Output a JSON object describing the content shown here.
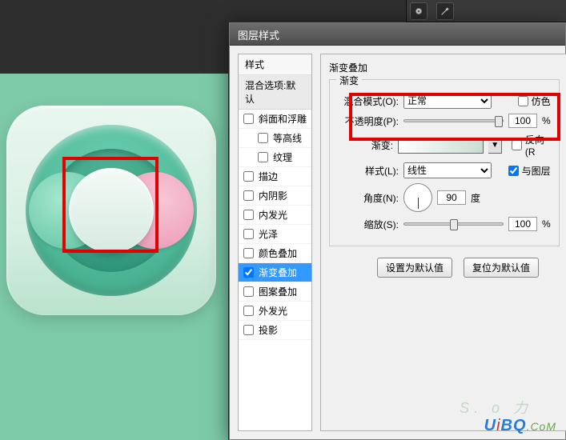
{
  "dialog": {
    "title": "图层样式",
    "styles_panel_title": "样式",
    "blend_default": "混合选项:默认",
    "styles": [
      {
        "label": "斜面和浮雕",
        "checked": false,
        "indent": false
      },
      {
        "label": "等高线",
        "checked": false,
        "indent": true
      },
      {
        "label": "纹理",
        "checked": false,
        "indent": true
      },
      {
        "label": "描边",
        "checked": false,
        "indent": false
      },
      {
        "label": "内阴影",
        "checked": false,
        "indent": false
      },
      {
        "label": "内发光",
        "checked": false,
        "indent": false
      },
      {
        "label": "光泽",
        "checked": false,
        "indent": false
      },
      {
        "label": "颜色叠加",
        "checked": false,
        "indent": false
      },
      {
        "label": "渐变叠加",
        "checked": true,
        "indent": false,
        "selected": true
      },
      {
        "label": "图案叠加",
        "checked": false,
        "indent": false
      },
      {
        "label": "外发光",
        "checked": false,
        "indent": false
      },
      {
        "label": "投影",
        "checked": false,
        "indent": false
      }
    ]
  },
  "settings": {
    "section_title": "渐变叠加",
    "fieldset_title": "渐变",
    "blend_mode_label": "混合模式(O):",
    "blend_mode_value": "正常",
    "dither_label": "仿色",
    "dither_checked": false,
    "opacity_label": "不透明度(P):",
    "opacity_value": "100",
    "opacity_unit": "%",
    "gradient_label": "渐变:",
    "reverse_label": "反向(R",
    "reverse_checked": false,
    "style_label": "样式(L):",
    "style_value": "线性",
    "align_label": "与图层",
    "align_checked": true,
    "angle_label": "角度(N):",
    "angle_value": "90",
    "angle_unit": "度",
    "scale_label": "缩放(S):",
    "scale_value": "100",
    "scale_unit": "%",
    "btn_default": "设置为默认值",
    "btn_reset": "复位为默认值"
  },
  "watermark": {
    "shadow": "S. o 力",
    "text": "UiBQ.CoM"
  }
}
